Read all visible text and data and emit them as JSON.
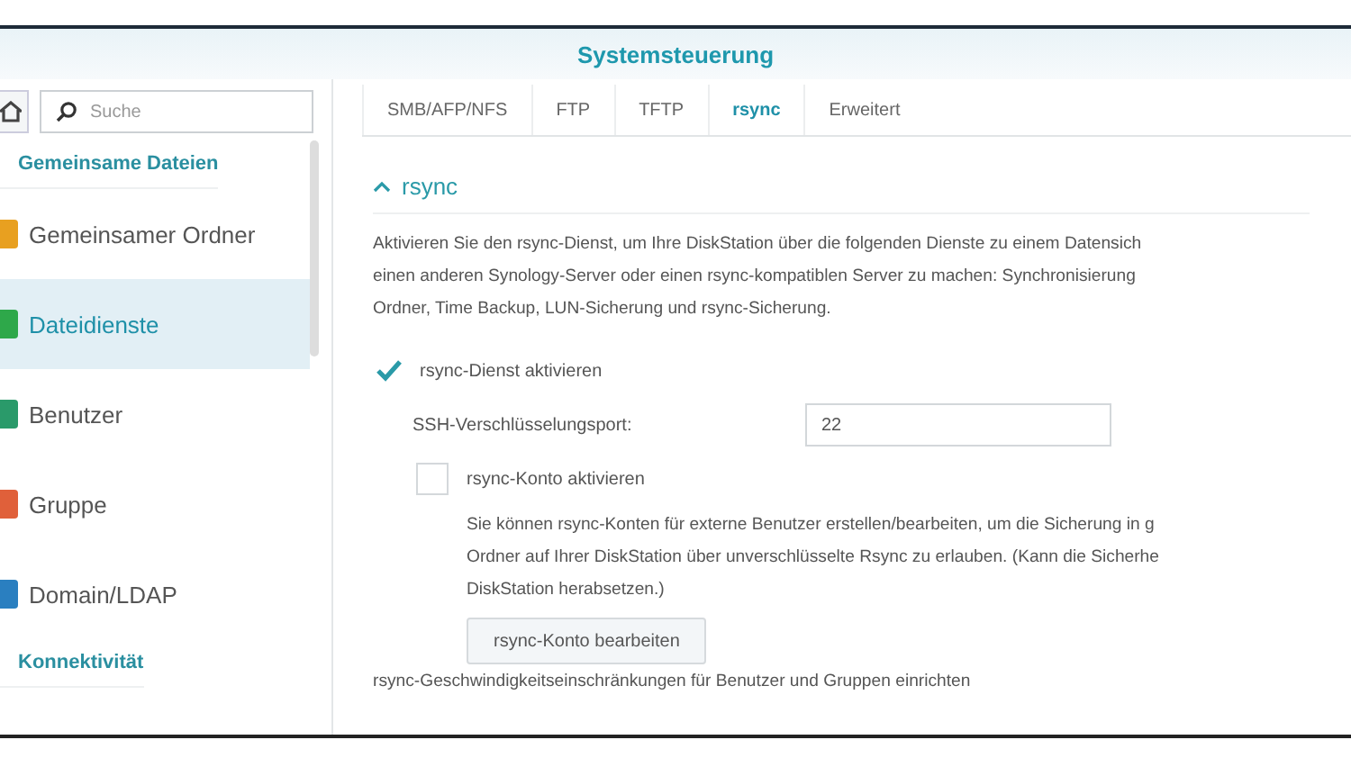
{
  "window": {
    "title": "Systemsteuerung"
  },
  "sidebar": {
    "search": {
      "placeholder": "Suche"
    },
    "items": [
      {
        "kind": "header",
        "label": "Gemeinsame Dateien",
        "selected": false
      },
      {
        "kind": "item",
        "label": "Gemeinsamer Ordner",
        "selected": false
      },
      {
        "kind": "item",
        "label": "Dateidienste",
        "selected": true
      },
      {
        "kind": "item",
        "label": "Benutzer",
        "selected": false
      },
      {
        "kind": "item",
        "label": "Gruppe",
        "selected": false
      },
      {
        "kind": "item",
        "label": "Domain/LDAP",
        "selected": false
      },
      {
        "kind": "header",
        "label": "Konnektivität",
        "selected": false
      }
    ]
  },
  "tabs": [
    {
      "label": "SMB/AFP/NFS",
      "selected": false
    },
    {
      "label": "FTP",
      "selected": false
    },
    {
      "label": "TFTP",
      "selected": false
    },
    {
      "label": "rsync",
      "selected": true
    },
    {
      "label": "Erweitert",
      "selected": false
    }
  ],
  "section": {
    "title": "rsync",
    "expanded": true,
    "description_lines": [
      "Aktivieren Sie den rsync-Dienst, um Ihre DiskStation über die folgenden Dienste zu einem Datensich",
      "einen anderen Synology-Server oder einen rsync-kompatiblen Server zu machen: Synchronisierung",
      "Ordner, Time Backup, LUN-Sicherung und rsync-Sicherung."
    ],
    "enable_service": {
      "label": "rsync-Dienst aktivieren",
      "checked": true
    },
    "ssh_port": {
      "label": "SSH-Verschlüsselungsport:",
      "value": "22"
    },
    "enable_account": {
      "label": "rsync-Konto aktivieren",
      "checked": false
    },
    "account_note_lines": [
      "Sie können rsync-Konten für externe Benutzer erstellen/bearbeiten, um die Sicherung in g",
      "Ordner auf Ihrer DiskStation über unverschlüsselte Rsync zu erlauben. (Kann die Sicherhe",
      "DiskStation herabsetzen.)"
    ],
    "edit_button": "rsync-Konto bearbeiten",
    "speed_limit_text": "rsync-Geschwindigkeitseinschränkungen für Benutzer und Gruppen einrichten"
  }
}
